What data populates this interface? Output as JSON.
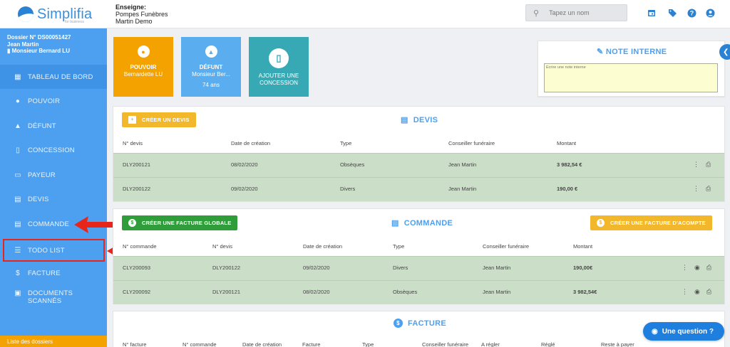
{
  "brand": {
    "name": "Simplifia",
    "sub": "for business"
  },
  "header": {
    "enseigne_label": "Enseigne:",
    "enseigne_line1": "Pompes Funèbres",
    "enseigne_line2": "Martin Demo",
    "search_placeholder": "Tapez un nom"
  },
  "icons": {
    "calendar": "calendar-icon",
    "tag": "tag-icon",
    "help": "help-icon",
    "user": "user-icon"
  },
  "sidebar": {
    "dossier": "Dossier N° DS00051427",
    "client": "Jean Martin",
    "defunt": "Monsieur Bernard LU",
    "items": [
      {
        "label": "TABLEAU DE BORD",
        "icon": "dashboard-icon"
      },
      {
        "label": "POUVOIR",
        "icon": "person-icon"
      },
      {
        "label": "DÉFUNT",
        "icon": "urn-icon"
      },
      {
        "label": "CONCESSION",
        "icon": "tomb-icon"
      },
      {
        "label": "PAYEUR",
        "icon": "card-icon"
      },
      {
        "label": "DEVIS",
        "icon": "document-icon"
      },
      {
        "label": "COMMANDE",
        "icon": "document-icon"
      },
      {
        "label": "TODO LIST",
        "icon": "list-icon"
      },
      {
        "label": "FACTURE",
        "icon": "dollar-icon"
      },
      {
        "label": "DOCUMENTS",
        "label2": "SCANNÉS",
        "icon": "scan-icon"
      }
    ],
    "list_link": "Liste des dossiers"
  },
  "cards": {
    "pouvoir": {
      "title": "POUVOIR",
      "line": "Bernardette LU",
      "color": "#f3a200"
    },
    "defunt": {
      "title": "DÉFUNT",
      "line": "Monsieur Ber...",
      "age": "74 ans",
      "color": "#5aaef0"
    },
    "concession": {
      "title": "AJOUTER UNE",
      "title2": "CONCESSION",
      "color": "#36a9b5"
    }
  },
  "note": {
    "title": "NOTE INTERNE",
    "placeholder": "Ecrire une note interne"
  },
  "devis": {
    "title": "DEVIS",
    "button": "CRÉER UN DEVIS",
    "headers": [
      "N° devis",
      "Date de création",
      "Type",
      "Conseiller funéraire",
      "Montant"
    ],
    "rows": [
      [
        "DLY200121",
        "08/02/2020",
        "Obsèques",
        "Jean Martin",
        "3 982,54 €"
      ],
      [
        "DLY200122",
        "09/02/2020",
        "Divers",
        "Jean Martin",
        "190,00 €"
      ]
    ]
  },
  "commande": {
    "title": "COMMANDE",
    "button_left": "CRÉER UNE FACTURE GLOBALE",
    "button_right": "CRÉER UNE FACTURE D'ACOMPTE",
    "headers": [
      "N° commande",
      "N° devis",
      "Date de création",
      "Type",
      "Conseiller funéraire",
      "Montant"
    ],
    "rows": [
      [
        "CLY200093",
        "DLY200122",
        "09/02/2020",
        "Divers",
        "Jean Martin",
        "190,00€"
      ],
      [
        "CLY200092",
        "DLY200121",
        "08/02/2020",
        "Obsèques",
        "Jean Martin",
        "3 982,54€"
      ]
    ]
  },
  "facture": {
    "title": "FACTURE",
    "headers": [
      "N° facture",
      "N° commande",
      "Date de création",
      "Facture",
      "Type",
      "Conseiller funéraire",
      "A régler",
      "Réglé",
      "Reste à payer"
    ]
  },
  "help": "Une question ?",
  "colors": {
    "sidebar": "#4da0ef",
    "accent": "#4da0ef",
    "green_row": "#cbdfc8",
    "orange": "#f3a200",
    "green_btn": "#2e9d3a",
    "annotation": "#e8251b"
  }
}
